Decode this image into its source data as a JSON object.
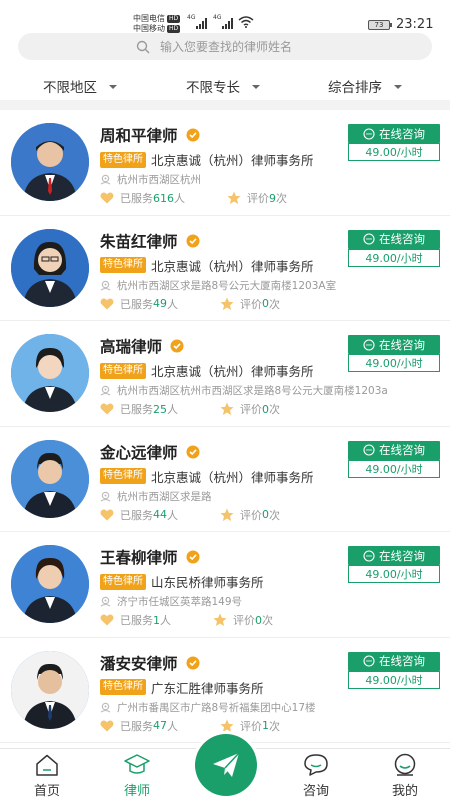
{
  "status_bar": {
    "carrier1": "中国电信",
    "carrier2": "中国移动",
    "hd": "HD",
    "net1": "4G",
    "net2": "4G",
    "battery": "73",
    "time": "23:21"
  },
  "search": {
    "placeholder": "输入您要查找的律师姓名"
  },
  "filters": {
    "region": "不限地区",
    "specialty": "不限专长",
    "sort": "综合排序"
  },
  "lawyers": [
    {
      "name": "周和平律师",
      "tag": "特色律所",
      "firm": "北京惠诚（杭州）律师事务所",
      "address": "杭州市西湖区杭州",
      "served_label": "已服务",
      "served": "616",
      "served_unit": "人",
      "rating_label": "评价",
      "rating": "9",
      "rating_unit": "次",
      "consult": "在线咨询",
      "price": "49.00/小时"
    },
    {
      "name": "朱苗红律师",
      "tag": "特色律所",
      "firm": "北京惠诚（杭州）律师事务所",
      "address": "杭州市西湖区求是路8号公元大厦南楼1203A室",
      "served_label": "已服务",
      "served": "49",
      "served_unit": "人",
      "rating_label": "评价",
      "rating": "0",
      "rating_unit": "次",
      "consult": "在线咨询",
      "price": "49.00/小时"
    },
    {
      "name": "高瑞律师",
      "tag": "特色律所",
      "firm": "北京惠诚（杭州）律师事务所",
      "address": "杭州市西湖区杭州市西湖区求是路8号公元大厦南楼1203a",
      "served_label": "已服务",
      "served": "25",
      "served_unit": "人",
      "rating_label": "评价",
      "rating": "0",
      "rating_unit": "次",
      "consult": "在线咨询",
      "price": "49.00/小时"
    },
    {
      "name": "金心远律师",
      "tag": "特色律所",
      "firm": "北京惠诚（杭州）律师事务所",
      "address": "杭州市西湖区求是路",
      "served_label": "已服务",
      "served": "44",
      "served_unit": "人",
      "rating_label": "评价",
      "rating": "0",
      "rating_unit": "次",
      "consult": "在线咨询",
      "price": "49.00/小时"
    },
    {
      "name": "王春柳律师",
      "tag": "特色律所",
      "firm": "山东民桥律师事务所",
      "address": "济宁市任城区英萃路149号",
      "served_label": "已服务",
      "served": "1",
      "served_unit": "人",
      "rating_label": "评价",
      "rating": "0",
      "rating_unit": "次",
      "consult": "在线咨询",
      "price": "49.00/小时"
    },
    {
      "name": "潘安安律师",
      "tag": "特色律所",
      "firm": "广东汇胜律师事务所",
      "address": "广州市番禺区市广路8号祈福集团中心17楼",
      "served_label": "已服务",
      "served": "47",
      "served_unit": "人",
      "rating_label": "评价",
      "rating": "1",
      "rating_unit": "次",
      "consult": "在线咨询",
      "price": "49.00/小时"
    }
  ],
  "tabbar": {
    "home": "首页",
    "lawyer": "律师",
    "consult": "咨询",
    "mine": "我的"
  },
  "colors": {
    "accent": "#1a9f6b",
    "tag": "#f1a21b",
    "verified": "#f1a21b"
  }
}
